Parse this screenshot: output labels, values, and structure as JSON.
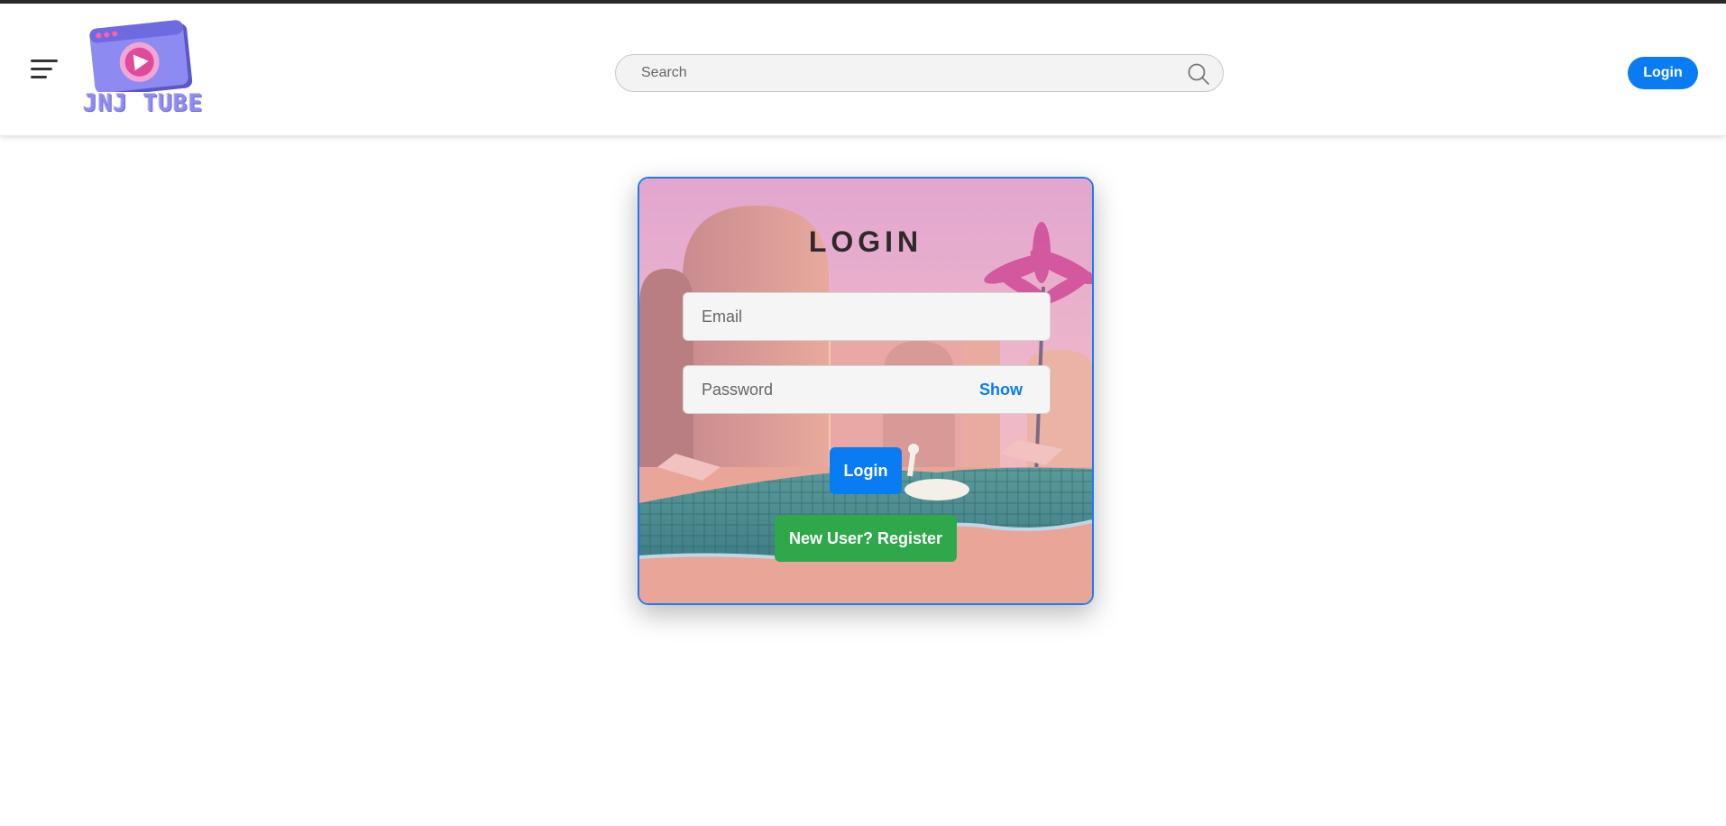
{
  "header": {
    "brand_text": "JNJ TUBE",
    "search": {
      "placeholder": "Search",
      "value": ""
    },
    "login_label": "Login"
  },
  "login_card": {
    "title": "LOGIN",
    "email": {
      "placeholder": "Email",
      "value": ""
    },
    "password": {
      "placeholder": "Password",
      "value": ""
    },
    "show_label": "Show",
    "submit_label": "Login",
    "register_label": "New User? Register"
  },
  "colors": {
    "primary": "#0a7cf3",
    "success": "#2ea84a",
    "brand": "#8f8cf0",
    "card_border": "#1f7cf0"
  },
  "icons": [
    "menu-icon",
    "logo-icon",
    "search-icon"
  ]
}
